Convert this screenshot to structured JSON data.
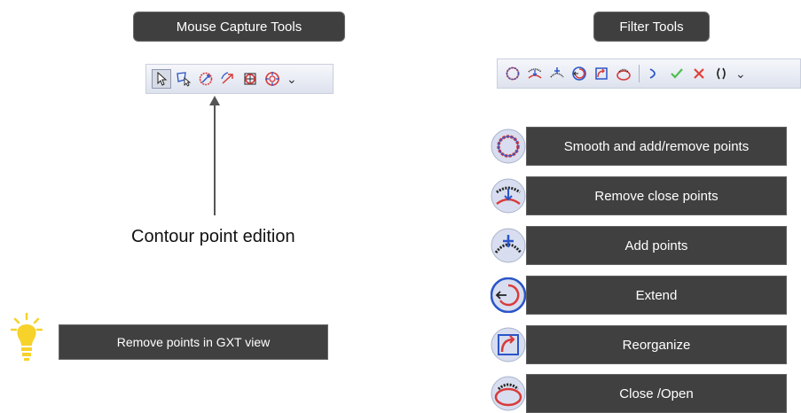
{
  "mouse_capture": {
    "header": "Mouse Capture Tools",
    "tools": [
      "select-pointer-icon",
      "polygon-pointer-icon",
      "contour-edit-icon",
      "drag-arrow-icon",
      "grid-contour-icon",
      "target-contour-icon"
    ],
    "caption": "Contour point edition"
  },
  "filter": {
    "header": "Filter Tools",
    "tools": [
      "smooth-icon",
      "remove-close-points-icon",
      "add-points-icon",
      "extend-icon",
      "reorganize-icon",
      "close-open-icon",
      "curve-icon",
      "check-icon",
      "cross-icon",
      "parentheses-icon"
    ],
    "items": [
      {
        "label": "Smooth and add/remove points",
        "icon": "smooth-icon"
      },
      {
        "label": "Remove close points",
        "icon": "remove-close-points-icon"
      },
      {
        "label": "Add points",
        "icon": "add-points-icon"
      },
      {
        "label": "Extend",
        "icon": "extend-icon"
      },
      {
        "label": "Reorganize",
        "icon": "reorganize-icon"
      },
      {
        "label": "Close /Open",
        "icon": "close-open-icon"
      }
    ]
  },
  "tip": {
    "label": "Remove points in GXT view",
    "icon": "lightbulb-icon"
  },
  "colors": {
    "box_bg": "#404040",
    "toolbar_bg": "#e3e7f1",
    "contour_red": "#d93a3a",
    "contour_blue": "#2b55c8",
    "bulb_yellow": "#f6d22b"
  }
}
